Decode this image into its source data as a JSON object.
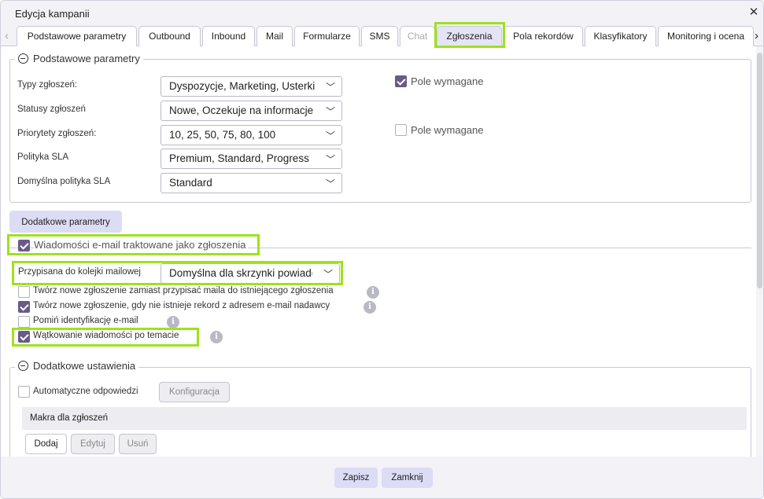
{
  "window": {
    "title": "Edycja kampanii",
    "close_icon": "close-icon"
  },
  "tabs": [
    {
      "label": "Podstawowe parametry",
      "state": "normal"
    },
    {
      "label": "Outbound",
      "state": "normal"
    },
    {
      "label": "Inbound",
      "state": "normal"
    },
    {
      "label": "Mail",
      "state": "normal"
    },
    {
      "label": "Formularze",
      "state": "normal"
    },
    {
      "label": "SMS",
      "state": "normal"
    },
    {
      "label": "Chat",
      "state": "disabled"
    },
    {
      "label": "Zgłoszenia",
      "state": "active"
    },
    {
      "label": "Pola rekordów",
      "state": "normal"
    },
    {
      "label": "Klasyfikatory",
      "state": "normal"
    },
    {
      "label": "Monitoring i ocena",
      "state": "normal"
    }
  ],
  "basic": {
    "legend": "Podstawowe parametry",
    "fields": [
      {
        "label": "Typy zgłoszeń:",
        "value": "Dyspozycje, Marketing, Usterki"
      },
      {
        "label": "Statusy zgłoszeń",
        "value": "Nowe, Oczekuje na informacje"
      },
      {
        "label": "Priorytety zgłoszeń:",
        "value": "10, 25, 50, 75, 80, 100"
      },
      {
        "label": "Polityka SLA",
        "value": "Premium, Standard, Progress"
      },
      {
        "label": "Domyślna polityka SLA",
        "value": "Standard"
      }
    ],
    "required": [
      {
        "label": "Pole wymagane",
        "checked": true
      },
      {
        "label": "Pole wymagane",
        "checked": false
      }
    ]
  },
  "extra_params_button": "Dodatkowe parametry",
  "email": {
    "main_label": "Wiadomości e-mail traktowane jako zgłoszenia",
    "main_checked": true,
    "queue_label": "Przypisana do kolejki mailowej",
    "queue_value": "Domyślna dla skrzynki powiadomień",
    "options": [
      {
        "label": "Twórz nowe zgłoszenie zamiast przypisać maila do istniejącego zgłoszenia",
        "checked": false
      },
      {
        "label": "Twórz nowe zgłoszenie, gdy nie istnieje rekord z adresem e-mail nadawcy",
        "checked": true
      },
      {
        "label": "Pomiń identyfikację e-mail",
        "checked": false
      },
      {
        "label": "Wątkowanie wiadomości po temacie",
        "checked": true
      }
    ]
  },
  "additional": {
    "legend": "Dodatkowe ustawienia",
    "auto_label": "Automatyczne odpowiedzi",
    "auto_checked": false,
    "config_button": "Konfiguracja",
    "macros_header": "Makra dla zgłoszeń",
    "macro_buttons": [
      {
        "label": "Dodaj",
        "enabled": true
      },
      {
        "label": "Edytuj",
        "enabled": false
      },
      {
        "label": "Usuń",
        "enabled": false
      }
    ]
  },
  "footer": {
    "save": "Zapisz",
    "close": "Zamknij"
  },
  "colors": {
    "accent": "#6a5a8a",
    "highlight": "#9ee21b",
    "active_tab": "#e4e4f6",
    "button": "#dcdcf5"
  }
}
